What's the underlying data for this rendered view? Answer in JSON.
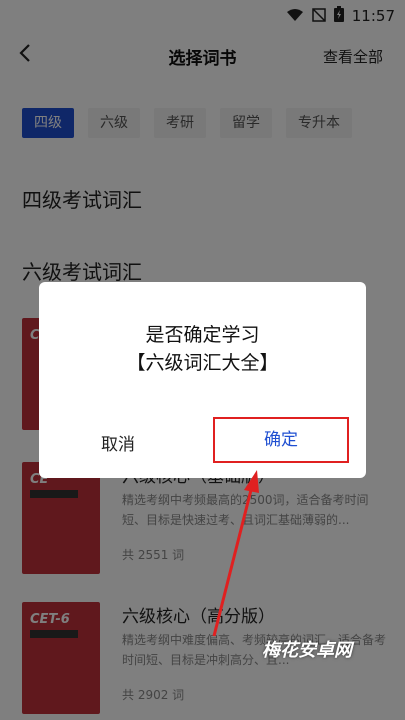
{
  "status": {
    "time": "11:57",
    "icons": [
      "wifi-icon",
      "signal-off-icon",
      "battery-icon"
    ]
  },
  "header": {
    "title": "选择词书",
    "view_all": "查看全部",
    "back_icon": "chevron-left-icon"
  },
  "tabs": [
    {
      "label": "四级",
      "active": true
    },
    {
      "label": "六级",
      "active": false
    },
    {
      "label": "考研",
      "active": false
    },
    {
      "label": "留学",
      "active": false
    },
    {
      "label": "专升本",
      "active": false
    }
  ],
  "sections": {
    "cet4": "四级考试词汇",
    "cet6": "六级考试词汇"
  },
  "books": [
    {
      "cover_title": "C",
      "title": "",
      "desc": "",
      "count": ""
    },
    {
      "cover_title": "CE",
      "title": "六级核心（基础版）",
      "desc": "精选考纲中考频最高的2500词，适合备考时间短、目标是快速过考、且词汇基础薄弱的...",
      "count": "共 2551 词"
    },
    {
      "cover_title": "CET-6",
      "title": "六级核心（高分版）",
      "desc": "精选考纲中难度偏高、考频较高的词汇，适合备考时间短、目标是冲刺高分、且...",
      "count": "共 2902 词"
    }
  ],
  "dialog": {
    "line1": "是否确定学习",
    "line2": "【六级词汇大全】",
    "cancel": "取消",
    "confirm": "确定"
  },
  "colors": {
    "accent": "#1f4fd1",
    "highlight": "#e02020",
    "cover": "#c0303b"
  },
  "watermark": "梅花安卓网"
}
